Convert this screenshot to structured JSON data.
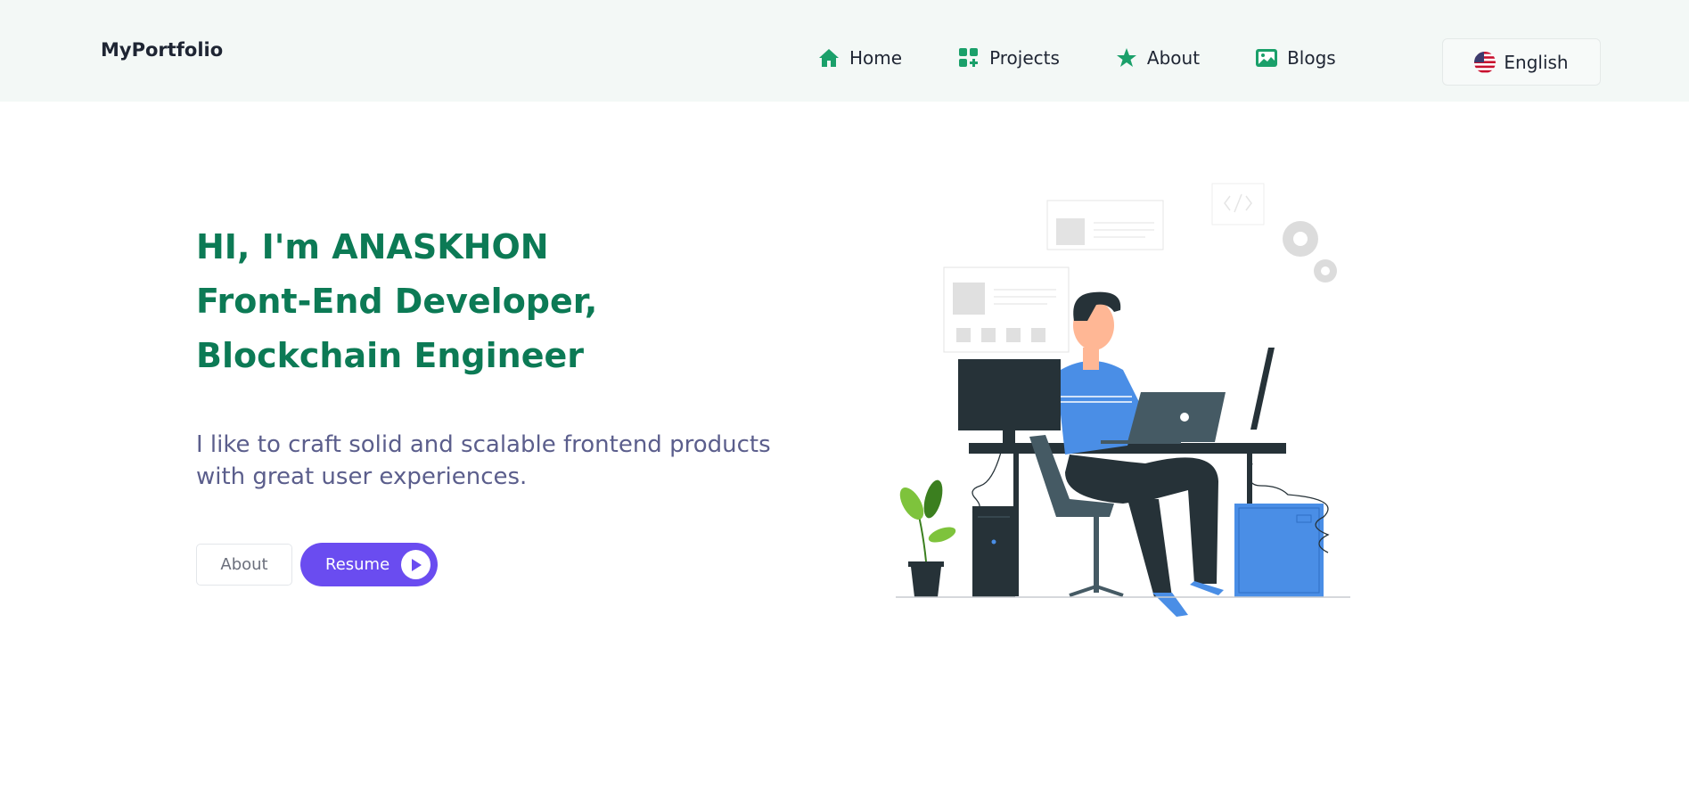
{
  "header": {
    "logo": "MyPortfolio",
    "nav": [
      {
        "label": "Home",
        "icon": "home-icon"
      },
      {
        "label": "Projects",
        "icon": "grid-plus-icon"
      },
      {
        "label": "About",
        "icon": "star-icon"
      },
      {
        "label": "Blogs",
        "icon": "image-icon"
      }
    ],
    "language": {
      "label": "English",
      "icon": "us-flag-icon"
    }
  },
  "hero": {
    "line1": "HI, I'm ANASKHON",
    "line2": "Front-End Developer,",
    "line3": "Blockchain Engineer",
    "tagline": "I like to craft solid and scalable frontend products with great user experiences.",
    "about_button": "About",
    "resume_button": "Resume"
  },
  "colors": {
    "accent_green": "#0c7a55",
    "icon_green": "#1aa06a",
    "primary_purple": "#6a4cf0",
    "header_bg": "#f3f8f6"
  }
}
